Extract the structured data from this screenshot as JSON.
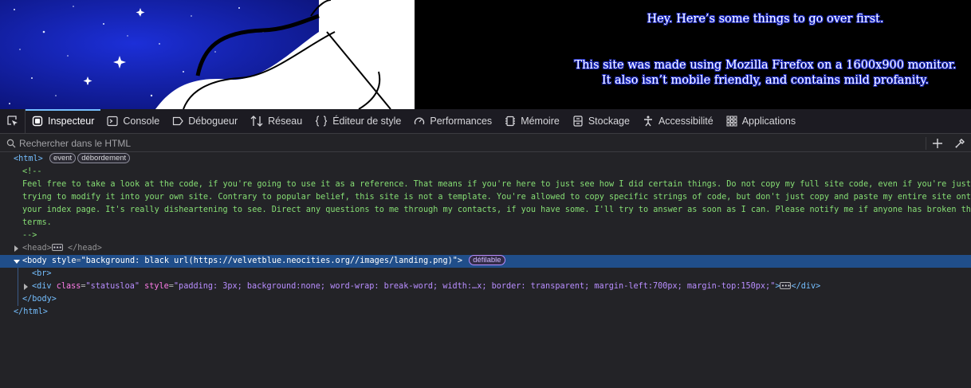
{
  "page": {
    "notice_line1": "Hey. Here’s some things to go over first.",
    "notice_line2": "This site was made using Mozilla Firefox on a 1600x900 monitor.",
    "notice_line3": "It also isn’t mobile friendly, and contains mild profanity."
  },
  "toolbar": {
    "tabs": [
      {
        "label": "Inspecteur",
        "icon": "inspector-icon",
        "active": true
      },
      {
        "label": "Console",
        "icon": "console-icon"
      },
      {
        "label": "Débogueur",
        "icon": "debugger-icon"
      },
      {
        "label": "Réseau",
        "icon": "network-icon"
      },
      {
        "label": "Éditeur de style",
        "icon": "style-editor-icon"
      },
      {
        "label": "Performances",
        "icon": "performance-icon"
      },
      {
        "label": "Mémoire",
        "icon": "memory-icon"
      },
      {
        "label": "Stockage",
        "icon": "storage-icon"
      },
      {
        "label": "Accessibilité",
        "icon": "accessibility-icon"
      },
      {
        "label": "Applications",
        "icon": "applications-icon"
      }
    ]
  },
  "search": {
    "placeholder": "Rechercher dans le HTML"
  },
  "tree": {
    "html_open": "<html>",
    "html_badge_event": "event",
    "html_badge_overflow": "débordement",
    "comment_open": "<!--",
    "comment_lines": [
      "Feel free to take a look at the code, if you're going to use it as a reference. That means if you're here to just see how I did certain things. Do not copy my full site code, even if you're just",
      "trying to modify it into your own site. Contrary to popular belief, this site is not a template. You're allowed to copy specific strings of code, but don't just copy and paste my entire site onto",
      "your index page. It's really disheartening to see. Direct any questions to me through my contacts, if you have some. I'll try to answer as soon as I can. Please notify me if anyone has broken these",
      "terms."
    ],
    "comment_close": "-->",
    "head_open": "<head>",
    "head_close": "</head>",
    "body_tag": "<body",
    "body_attr_name": "style",
    "body_attr_value": "\"background: black url(https://velvetblue.neocities.org//images/landing.png)\"",
    "body_tag_end": ">",
    "body_badge": "défilable",
    "br": "<br>",
    "div_tag": "<div",
    "div_attr1_name": "class",
    "div_attr1_value": "\"statusloa\"",
    "div_attr2_name": "style",
    "div_attr2_value": "\"padding: 3px; background:none; word-wrap: break-word; width:…x; border: transparent; margin-left:700px; margin-top:150px;\"",
    "div_tag_end": ">",
    "div_close": "</div>",
    "body_close": "</body>",
    "html_close": "</html>"
  },
  "colors": {
    "selection": "#204e8a",
    "accent": "#75bfff",
    "panel": "#232327",
    "toolbar": "#1c1b22"
  }
}
